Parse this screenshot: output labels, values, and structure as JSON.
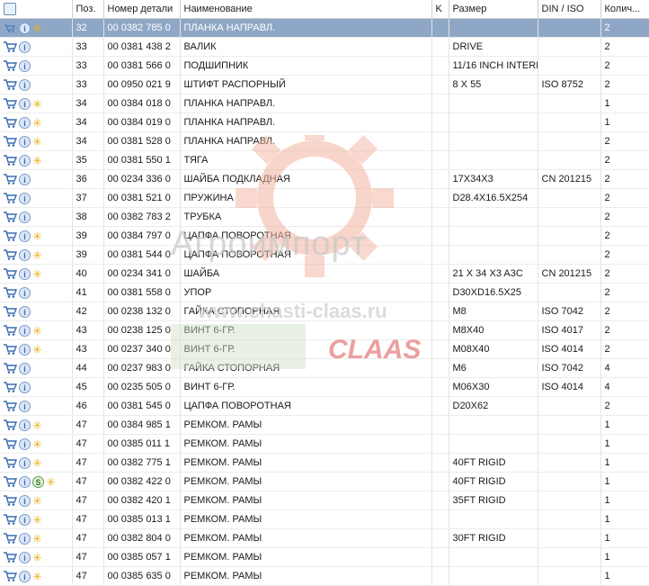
{
  "columns": {
    "icons": "",
    "pos": "Поз.",
    "part_no": "Номер детали",
    "name": "Наименование",
    "k": "K",
    "size": "Размер",
    "din": "DIN / ISO",
    "qty": "Колич..."
  },
  "watermark": {
    "line1": "Агроимпорт",
    "line2": "www.chasti-claas.ru",
    "brand": "CLAAS"
  },
  "rows": [
    {
      "pos": "32",
      "part": "00 0382 785 0",
      "name": "ПЛАНКА НАПРАВЛ.",
      "size": "",
      "din": "",
      "qty": "2",
      "icons": [
        "cart-small",
        "info",
        "star"
      ],
      "selected": true
    },
    {
      "pos": "33",
      "part": "00 0381 438 2",
      "name": "ВАЛИК",
      "size": "DRIVE",
      "din": "",
      "qty": "2",
      "icons": [
        "cart",
        "info"
      ]
    },
    {
      "pos": "33",
      "part": "00 0381 566 0",
      "name": "ПОДШИПНИК",
      "size": "11/16 INCH INTERN",
      "din": "",
      "qty": "2",
      "icons": [
        "cart",
        "info"
      ]
    },
    {
      "pos": "33",
      "part": "00 0950 021 9",
      "name": "ШТИФТ РАСПОРНЫЙ",
      "size": "8  X 55",
      "din": "ISO 8752",
      "qty": "2",
      "icons": [
        "cart",
        "info"
      ]
    },
    {
      "pos": "34",
      "part": "00 0384 018 0",
      "name": "ПЛАНКА НАПРАВЛ.",
      "size": "",
      "din": "",
      "qty": "1",
      "icons": [
        "cart",
        "info",
        "star"
      ]
    },
    {
      "pos": "34",
      "part": "00 0384 019 0",
      "name": "ПЛАНКА НАПРАВЛ.",
      "size": "",
      "din": "",
      "qty": "1",
      "icons": [
        "cart",
        "info",
        "star"
      ]
    },
    {
      "pos": "34",
      "part": "00 0381 528 0",
      "name": "ПЛАНКА НАПРАВЛ.",
      "size": "",
      "din": "",
      "qty": "2",
      "icons": [
        "cart",
        "info",
        "star"
      ]
    },
    {
      "pos": "35",
      "part": "00 0381 550 1",
      "name": "ТЯГА",
      "size": "",
      "din": "",
      "qty": "2",
      "icons": [
        "cart",
        "info",
        "star"
      ]
    },
    {
      "pos": "36",
      "part": "00 0234 336 0",
      "name": "ШАЙБА ПОДКЛАДНАЯ",
      "size": "17X34X3",
      "din": "CN 201215",
      "qty": "2",
      "icons": [
        "cart",
        "info"
      ]
    },
    {
      "pos": "37",
      "part": "00 0381 521 0",
      "name": "ПРУЖИНА",
      "size": "D28.4X16.5X254",
      "din": "",
      "qty": "2",
      "icons": [
        "cart",
        "info"
      ]
    },
    {
      "pos": "38",
      "part": "00 0382 783 2",
      "name": "ТРУБКА",
      "size": "",
      "din": "",
      "qty": "2",
      "icons": [
        "cart",
        "info"
      ]
    },
    {
      "pos": "39",
      "part": "00 0384 797 0",
      "name": "ЦАПФА ПОВОРОТНАЯ",
      "size": "",
      "din": "",
      "qty": "2",
      "icons": [
        "cart",
        "info",
        "star"
      ]
    },
    {
      "pos": "39",
      "part": "00 0381 544 0",
      "name": "ЦАПФА ПОВОРОТНАЯ",
      "size": "",
      "din": "",
      "qty": "2",
      "icons": [
        "cart",
        "info",
        "star"
      ]
    },
    {
      "pos": "40",
      "part": "00 0234 341 0",
      "name": "ШАЙБА",
      "size": "21 X 34 X3 A3C",
      "din": "CN 201215",
      "qty": "2",
      "icons": [
        "cart",
        "info",
        "star"
      ]
    },
    {
      "pos": "41",
      "part": "00 0381 558 0",
      "name": "УПОР",
      "size": "D30XD16.5X25",
      "din": "",
      "qty": "2",
      "icons": [
        "cart",
        "info"
      ]
    },
    {
      "pos": "42",
      "part": "00 0238 132 0",
      "name": "ГАЙКА СТОПОРНАЯ",
      "size": "M8",
      "din": "ISO 7042",
      "qty": "2",
      "icons": [
        "cart",
        "info"
      ]
    },
    {
      "pos": "43",
      "part": "00 0238 125 0",
      "name": "ВИНТ 6-ГР.",
      "size": "M8X40",
      "din": "ISO 4017",
      "qty": "2",
      "icons": [
        "cart",
        "info",
        "star"
      ]
    },
    {
      "pos": "43",
      "part": "00 0237 340 0",
      "name": "ВИНТ 6-ГР.",
      "size": "M08X40",
      "din": "ISO 4014",
      "qty": "2",
      "icons": [
        "cart",
        "info",
        "star"
      ]
    },
    {
      "pos": "44",
      "part": "00 0237 983 0",
      "name": "ГАЙКА СТОПОРНАЯ",
      "size": "M6",
      "din": "ISO 7042",
      "qty": "4",
      "icons": [
        "cart",
        "info"
      ]
    },
    {
      "pos": "45",
      "part": "00 0235 505 0",
      "name": "ВИНТ 6-ГР.",
      "size": "M06X30",
      "din": "ISO 4014",
      "qty": "4",
      "icons": [
        "cart",
        "info"
      ]
    },
    {
      "pos": "46",
      "part": "00 0381 545 0",
      "name": "ЦАПФА ПОВОРОТНАЯ",
      "size": "D20X62",
      "din": "",
      "qty": "2",
      "icons": [
        "cart",
        "info"
      ]
    },
    {
      "pos": "47",
      "part": "00 0384 985 1",
      "name": "РЕМКОМ. РАМЫ",
      "size": "",
      "din": "",
      "qty": "1",
      "icons": [
        "cart",
        "info",
        "star"
      ]
    },
    {
      "pos": "47",
      "part": "00 0385 011 1",
      "name": "РЕМКОМ. РАМЫ",
      "size": "",
      "din": "",
      "qty": "1",
      "icons": [
        "cart",
        "info",
        "star"
      ]
    },
    {
      "pos": "47",
      "part": "00 0382 775 1",
      "name": "РЕМКОМ. РАМЫ",
      "size": "40FT RIGID",
      "din": "",
      "qty": "1",
      "icons": [
        "cart",
        "info",
        "star"
      ]
    },
    {
      "pos": "47",
      "part": "00 0382 422 0",
      "name": "РЕМКОМ. РАМЫ",
      "size": "40FT RIGID",
      "din": "",
      "qty": "1",
      "icons": [
        "cart",
        "info",
        "supersession",
        "star"
      ]
    },
    {
      "pos": "47",
      "part": "00 0382 420 1",
      "name": "РЕМКОМ. РАМЫ",
      "size": "35FT RIGID",
      "din": "",
      "qty": "1",
      "icons": [
        "cart",
        "info",
        "star"
      ]
    },
    {
      "pos": "47",
      "part": "00 0385 013 1",
      "name": "РЕМКОМ. РАМЫ",
      "size": "",
      "din": "",
      "qty": "1",
      "icons": [
        "cart",
        "info",
        "star"
      ]
    },
    {
      "pos": "47",
      "part": "00 0382 804 0",
      "name": "РЕМКОМ. РАМЫ",
      "size": "30FT RIGID",
      "din": "",
      "qty": "1",
      "icons": [
        "cart",
        "info",
        "star"
      ]
    },
    {
      "pos": "47",
      "part": "00 0385 057 1",
      "name": "РЕМКОМ. РАМЫ",
      "size": "",
      "din": "",
      "qty": "1",
      "icons": [
        "cart",
        "info",
        "star"
      ]
    },
    {
      "pos": "47",
      "part": "00 0385 635 0",
      "name": "РЕМКОМ. РАМЫ",
      "size": "",
      "din": "",
      "qty": "1",
      "icons": [
        "cart",
        "info",
        "star"
      ]
    }
  ]
}
